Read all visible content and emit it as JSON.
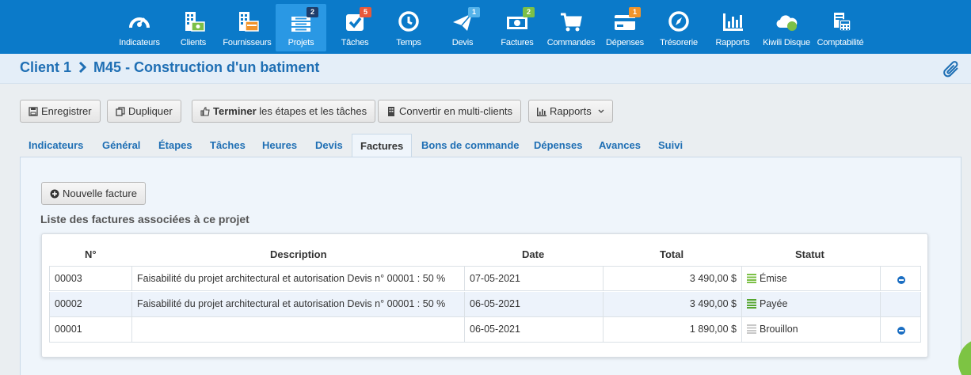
{
  "nav": {
    "items": [
      {
        "label": "Indicateurs",
        "icon": "gauge-icon"
      },
      {
        "label": "Clients",
        "icon": "building-money-icon"
      },
      {
        "label": "Fournisseurs",
        "icon": "building-card-icon"
      },
      {
        "label": "Projets",
        "icon": "projects-stack-icon",
        "badge": "2",
        "active": true
      },
      {
        "label": "Tâches",
        "icon": "task-check-icon",
        "badge": "5"
      },
      {
        "label": "Temps",
        "icon": "clock-icon"
      },
      {
        "label": "Devis",
        "icon": "paper-plane-icon",
        "badge": "1"
      },
      {
        "label": "Factures",
        "icon": "invoice-bill-icon",
        "badge": "2"
      },
      {
        "label": "Commandes",
        "icon": "cart-icon"
      },
      {
        "label": "Dépenses",
        "icon": "credit-card-icon",
        "badge": "1"
      },
      {
        "label": "Trésorerie",
        "icon": "compass-icon"
      },
      {
        "label": "Rapports",
        "icon": "bar-chart-icon"
      },
      {
        "label": "Kiwili Disque",
        "icon": "cloud-icon"
      },
      {
        "label": "Comptabilité",
        "icon": "calculator-icon"
      }
    ],
    "badge_colors": {
      "Projets": "#1e3d6b",
      "Tâches": "#e8593a",
      "Devis": "#55b3ea",
      "Factures": "#7cc047",
      "Dépenses": "#f0942b"
    }
  },
  "header": {
    "client": "Client 1",
    "separator": ">",
    "project": "M45 - Construction d'un batiment"
  },
  "toolbar": {
    "save": "Enregistrer",
    "duplicate": "Dupliquer",
    "finish_bold": "Terminer",
    "finish_rest": " les étapes et les tâches",
    "convert": "Convertir en multi-clients",
    "reports": "Rapports"
  },
  "tabs": [
    "Indicateurs",
    "Général",
    "Étapes",
    "Tâches",
    "Heures",
    "Devis",
    "Factures",
    "Bons de commande",
    "Dépenses",
    "Avances",
    "Suivi"
  ],
  "active_tab": "Factures",
  "panel": {
    "new_invoice": "Nouvelle facture",
    "section_title": "Liste des factures associées à ce projet"
  },
  "table": {
    "headers": {
      "num": "N°",
      "description": "Description",
      "date": "Date",
      "total": "Total",
      "status": "Statut"
    },
    "rows": [
      {
        "num": "00003",
        "description": "Faisabilité du projet architectural et autorisation Devis n° 00001 : 50 %",
        "date": "07-05-2021",
        "total": "3 490,00 $",
        "status": "Émise",
        "status_color": "#7cc047",
        "removable": true
      },
      {
        "num": "00002",
        "description": "Faisabilité du projet architectural et autorisation Devis n° 00001 : 50 %",
        "date": "06-05-2021",
        "total": "3 490,00 $",
        "status": "Payée",
        "status_color": "#56a630",
        "removable": false
      },
      {
        "num": "00001",
        "description": "",
        "date": "06-05-2021",
        "total": "1 890,00 $",
        "status": "Brouillon",
        "status_color": "#c8c8c8",
        "removable": true
      }
    ]
  },
  "colors": {
    "nav_bg": "#0b7ac9",
    "accent": "#1f6fb4",
    "header_bg": "#e4eef8"
  }
}
